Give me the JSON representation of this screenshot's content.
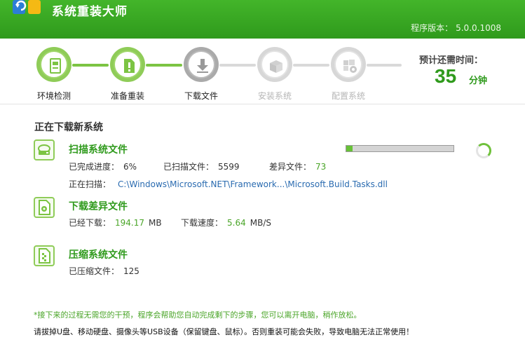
{
  "app": {
    "title": "系统重装大师",
    "version_label": "程序版本：",
    "version": "5.0.0.1008"
  },
  "steps": [
    {
      "label": "环境检测",
      "state": "done",
      "icon": "monitor-check-icon"
    },
    {
      "label": "准备重装",
      "state": "done",
      "icon": "document-alert-icon"
    },
    {
      "label": "下载文件",
      "state": "active",
      "icon": "download-icon"
    },
    {
      "label": "安装系统",
      "state": "pending",
      "icon": "install-box-icon"
    },
    {
      "label": "配置系统",
      "state": "pending",
      "icon": "windows-gear-icon"
    }
  ],
  "eta": {
    "label": "预计还需时间：",
    "value": "35",
    "unit": "分钟"
  },
  "main": {
    "section_title": "正在下载新系统",
    "scan": {
      "title": "扫描系统文件",
      "progress_label": "已完成进度：",
      "progress_value": "6%",
      "progress_fraction": 0.06,
      "scanned_label": "已扫描文件：",
      "scanned_value": "5599",
      "diff_label": "差异文件：",
      "diff_value": "73",
      "scanning_label": "正在扫描：",
      "scanning_path": "C:\\Windows\\Microsoft.NET\\Framework...\\Microsoft.Build.Tasks.dll"
    },
    "download": {
      "title": "下载差异文件",
      "downloaded_label": "已经下载：",
      "downloaded_value": "194.17",
      "downloaded_unit": "MB",
      "speed_label": "下载速度：",
      "speed_value": "5.64",
      "speed_unit": "MB/S"
    },
    "compress": {
      "title": "压缩系统文件",
      "compressed_label": "已压缩文件：",
      "compressed_value": "125"
    }
  },
  "footer": {
    "notice": "*接下来的过程无需您的干预，程序会帮助您自动完成剩下的步骤，您可以离开电脑，稍作放松。",
    "warning": "请拔掉U盘、移动硬盘、摄像头等USB设备（保留键盘、鼠标）。否则重装可能会失败，导致电脑无法正常使用！"
  },
  "colors": {
    "brand_green": "#2f9a1c",
    "progress_green": "#67c137",
    "path_blue": "#2a6bb0"
  }
}
